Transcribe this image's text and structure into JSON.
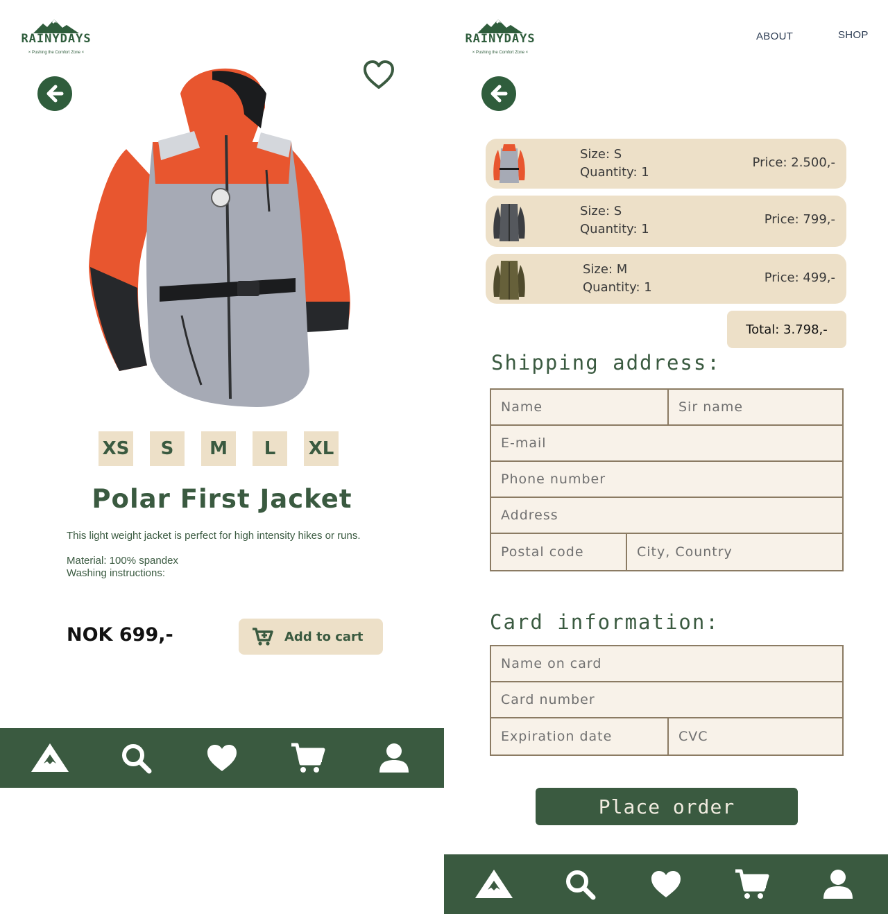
{
  "brand": {
    "name": "RAINYDAYS",
    "tagline": "× Pushing the Comfort Zone ×"
  },
  "product_page": {
    "sizes": [
      "XS",
      "S",
      "M",
      "L",
      "XL"
    ],
    "title": "Polar First Jacket",
    "description": "This light weight jacket is perfect for high intensity hikes or runs.",
    "material": "Material: 100% spandex",
    "washing": "Washing instructions:",
    "price": "NOK 699,-",
    "add_to_cart": "Add to cart"
  },
  "checkout_page": {
    "nav": {
      "about": "ABOUT",
      "shop": "SHOP"
    },
    "cart_items": [
      {
        "size": "Size: S",
        "quantity": "Quantity: 1",
        "price": "Price: 2.500,-"
      },
      {
        "size": "Size: S",
        "quantity": "Quantity: 1",
        "price": "Price: 799,-"
      },
      {
        "size": "Size: M",
        "quantity": "Quantity: 1",
        "price": "Price: 499,-"
      }
    ],
    "total": "Total: 3.798,-",
    "shipping_title": "Shipping address:",
    "shipping_fields": {
      "name": "Name",
      "surname": "Sir name",
      "email": "E-mail",
      "phone": "Phone number",
      "address": "Address",
      "postal": "Postal code",
      "city": "City, Country"
    },
    "card_title": "Card information:",
    "card_fields": {
      "name_on_card": "Name on card",
      "card_number": "Card number",
      "expiration": "Expiration date",
      "cvc": "CVC"
    },
    "place_order": "Place order"
  },
  "colors": {
    "brand_green": "#3a5a40",
    "beige": "#ede0c8",
    "field_bg": "#f8f2e9",
    "border": "#8b7b63"
  },
  "icons": [
    "home-mountain-icon",
    "search-icon",
    "heart-icon",
    "cart-icon",
    "user-icon"
  ]
}
